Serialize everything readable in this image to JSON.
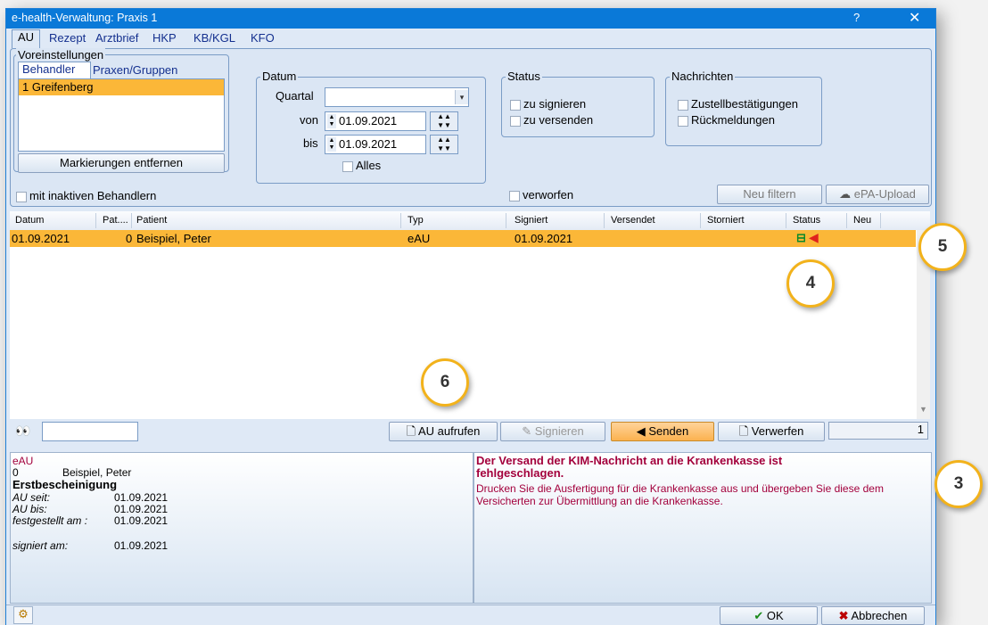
{
  "window": {
    "title": "e-health-Verwaltung: Praxis 1",
    "help": "?",
    "close": "✕"
  },
  "tabs": [
    "AU",
    "Rezept",
    "Arztbrief",
    "HKP",
    "KB/KGL",
    "KFO"
  ],
  "voreinstellungen": {
    "label": "Voreinstellungen",
    "subtabs": [
      "Behandler",
      "Praxen/Gruppen"
    ],
    "items": [
      "1 Greifenberg"
    ],
    "clear_button": "Markierungen entfernen",
    "inactive_checkbox": "mit inaktiven Behandlern"
  },
  "datum": {
    "label": "Datum",
    "quartal_label": "Quartal",
    "quartal_value": "",
    "von_label": "von",
    "von_value": "01.09.2021",
    "bis_label": "bis",
    "bis_value": "01.09.2021",
    "alles_label": "Alles"
  },
  "status_group": {
    "label": "Status",
    "options": [
      "zu signieren",
      "zu versenden"
    ]
  },
  "nachrichten": {
    "label": "Nachrichten",
    "options": [
      "Zustellbestätigungen",
      "Rückmeldungen"
    ]
  },
  "verworfen_label": "verworfen",
  "buttons": {
    "neu_filtern": "Neu filtern",
    "epa_upload": "ePA-Upload"
  },
  "table": {
    "columns": [
      "Datum",
      "Pat....",
      "Patient",
      "Typ",
      "Signiert",
      "Versendet",
      "Storniert",
      "Status",
      "Neu"
    ],
    "rows": [
      {
        "datum": "01.09.2021",
        "pat": "0",
        "patient": "Beispiel, Peter",
        "typ": "eAU",
        "signiert": "01.09.2021",
        "versendet": "",
        "storniert": "",
        "neu": ""
      }
    ]
  },
  "actions": {
    "au_aufrufen": "AU aufrufen",
    "signieren": "Signieren",
    "senden": "Senden",
    "verwerfen": "Verwerfen",
    "count": "1",
    "search_value": ""
  },
  "detail": {
    "type": "eAU",
    "pat_no": "0",
    "patient": "Beispiel, Peter",
    "heading": "Erstbescheinigung",
    "au_seit_label": "AU seit:",
    "au_seit": "01.09.2021",
    "au_bis_label": "AU bis:",
    "au_bis": "01.09.2021",
    "festgestellt_label": "festgestellt am :",
    "festgestellt": "01.09.2021",
    "signiert_label": "signiert am:",
    "signiert": "01.09.2021"
  },
  "message": {
    "title": "Der Versand der KIM-Nachricht an die Krankenkasse ist fehlgeschlagen.",
    "body": "Drucken Sie die Ausfertigung für die Krankenkasse aus und übergeben Sie diese dem Versicherten zur Übermittlung an die Krankenkasse."
  },
  "footer": {
    "ok": "OK",
    "abbrechen": "Abbrechen"
  },
  "callouts": [
    "3",
    "4",
    "5",
    "6"
  ],
  "colors": {
    "accent": "#0a79d8",
    "selection": "#fbb738",
    "callout_border": "#f2b21b",
    "message": "#a3003c"
  }
}
